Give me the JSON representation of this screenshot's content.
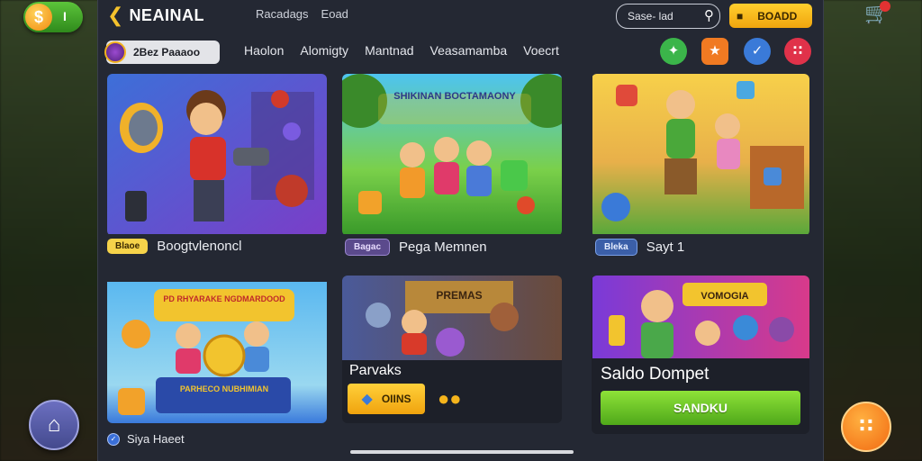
{
  "app": {
    "brand": "NEAINAL",
    "top_links": [
      "Racadags",
      "Eoad"
    ],
    "search": {
      "value": "Sase- lad"
    },
    "top_button": {
      "label": "BOADD"
    },
    "coin_count": "I",
    "profile": {
      "label": "2Bez Paaaoo"
    },
    "nav_tabs": [
      "Haolon",
      "Alomigty",
      "Mantnad",
      "Veasamamba",
      "Voecrt"
    ],
    "social_icons": [
      "star-icon",
      "gift-icon",
      "bird-icon",
      "grid-icon"
    ]
  },
  "cards": [
    {
      "badge": "Blaoe",
      "title": "Boogtvlenoncl",
      "art_text": ""
    },
    {
      "badge": "Bagac",
      "title": "Pega Memnen",
      "art_text": "SHIKINAN BOCTAMAONY"
    },
    {
      "badge": "Bleka",
      "title": "Sayt 1",
      "art_text": ""
    },
    {
      "art_text_top": "PD RHYARAKE NGDMARDOOD",
      "art_text_bottom": "PARHECO NUBHIMIAN"
    },
    {
      "art_text": "PREMAS",
      "title": "Parvaks",
      "button": "OIINS"
    },
    {
      "art_text": "VOMOGIA",
      "title": "Saldo Dompet",
      "button": "SANDKU"
    }
  ],
  "bottom_row": {
    "label": "Siya Haeet"
  },
  "colors": {
    "panel": "#242833",
    "accent_yellow": "#f6c22c",
    "accent_green": "#6cc82a"
  }
}
